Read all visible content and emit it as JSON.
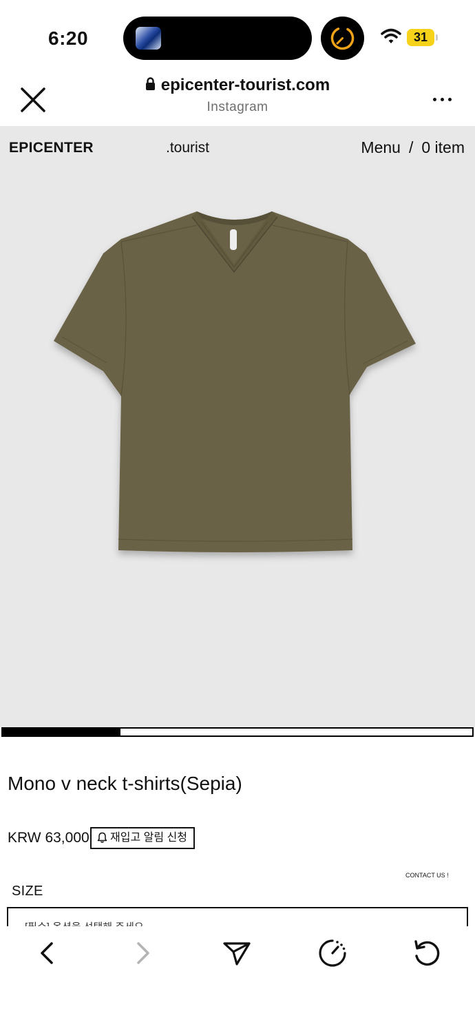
{
  "status_bar": {
    "time": "6:20",
    "battery": "31",
    "icons": [
      "live-activity-thumbnail",
      "timer-icon",
      "wifi-icon",
      "battery-icon"
    ]
  },
  "browser": {
    "url": "epicenter-tourist.com",
    "subtitle": "Instagram",
    "icons": [
      "close-icon",
      "lock-icon",
      "more-icon"
    ]
  },
  "site_nav": {
    "brand": "EPICENTER",
    "sub_brand": ".tourist",
    "menu": "Menu",
    "separator": "/",
    "cart": "0 item"
  },
  "gallery": {
    "progress": 0.25,
    "product_color": "#6b6246"
  },
  "product": {
    "title": "Mono v neck t-shirts(Sepia)",
    "price": "KRW 63,000",
    "restock_button": "재입고 알림 신청",
    "contact": "CONTACT US !",
    "size_label": "SIZE",
    "size_select": "[필수] 옵션을 선택해 주세요"
  },
  "toolbar": {
    "icons": [
      "back-icon",
      "forward-icon",
      "share-icon",
      "speed-icon",
      "reload-icon"
    ]
  },
  "colors": {
    "page_bg": "#e8e8e9",
    "battery": "#f6d31a",
    "timer": "#f3a317",
    "text": "#111111"
  }
}
